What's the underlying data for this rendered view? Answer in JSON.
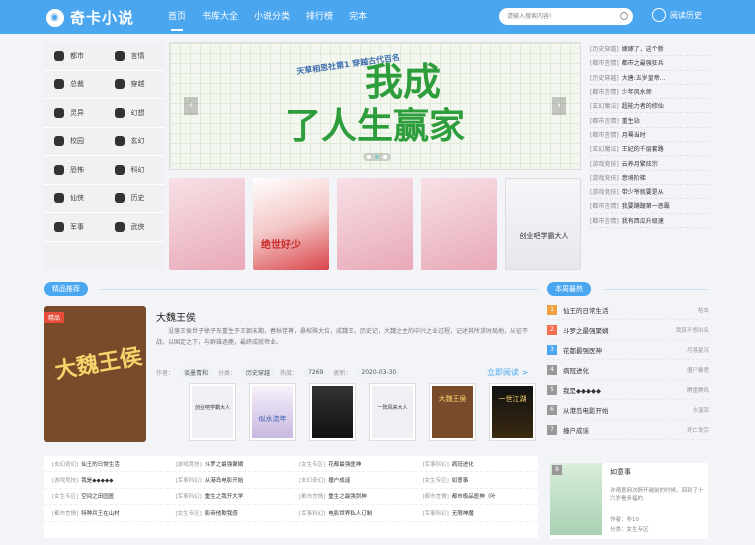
{
  "header": {
    "logo": "奇卡小说",
    "nav": [
      "首页",
      "书库大全",
      "小说分类",
      "排行榜",
      "完本"
    ],
    "search_placeholder": "请输入搜索内容!",
    "history": "阅读历史"
  },
  "categories": [
    "都市",
    "言情",
    "总裁",
    "穿越",
    "灵异",
    "幻想",
    "校园",
    "玄幻",
    "恐怖",
    "科幻",
    "仙侠",
    "历史",
    "军事",
    "武侠"
  ],
  "banner": {
    "subtitle": "天草相思社第1 穿越古代百名",
    "title_line1": "我成",
    "title_line2": "了人生赢家"
  },
  "cover_books": [
    {
      "title": ""
    },
    {
      "title": "绝世好少"
    },
    {
      "title": ""
    },
    {
      "title": ""
    },
    {
      "title": "创业吧学霸大人"
    }
  ],
  "recent_list": [
    {
      "tag": "[历史穿越]",
      "name": "嫁嫁了，这个新"
    },
    {
      "tag": "[都市言情]",
      "name": "都市之最强狂兵"
    },
    {
      "tag": "[历史穿越]",
      "name": "大唐:五岁皇帝..."
    },
    {
      "tag": "[都市言情]",
      "name": "少年风水师"
    },
    {
      "tag": "[玄幻魔法]",
      "name": "超能力者的修仙"
    },
    {
      "tag": "[都市言情]",
      "name": "重生站"
    },
    {
      "tag": "[都市言情]",
      "name": "月蓦当时"
    },
    {
      "tag": "[玄幻魔法]",
      "name": "王妃的千层套路"
    },
    {
      "tag": "[游戏竞技]",
      "name": "云养月繁炫宗"
    },
    {
      "tag": "[游戏竞技]",
      "name": "意境阶梯"
    },
    {
      "tag": "[游戏竞技]",
      "name": "带少爷就要是从"
    },
    {
      "tag": "[都市言情]",
      "name": "我要蹒跚第一恶霸"
    },
    {
      "tag": "[都市言情]",
      "name": "我有西瓜升级速"
    }
  ],
  "sections": {
    "featured": "精品推荐",
    "hot": "本周最热"
  },
  "featured_book": {
    "ribbon": "精品",
    "cover_title": "大魏王侯",
    "title": "大魏王侯",
    "description": "没落王侯世子徐子东重生于王朝末期，春秋荏苒，悬棺殊大位，成魏王。历史记，大魏之主的中兴之业过程，记述其所求时局地，从征不战，以国定之下，与群雄逐鹿，最终成就帝业。",
    "author_label": "作者：",
    "author": "谈墨青和",
    "category_label": "分类：",
    "category": "历史穿越",
    "views_label": "热度：",
    "views": "7269",
    "updated_label": "更新：",
    "updated": "2020-03-30",
    "read_now": "立即阅读 >"
  },
  "thumbs": [
    "创业吧学霸大人",
    "似水流年",
    "",
    "一阵风来大人",
    "大魏王侯",
    "一世江湖"
  ],
  "bottom_list": [
    {
      "tag": "[玄幻奇幻]",
      "name": "仙王的日常生活"
    },
    {
      "tag": "[游戏竞技]",
      "name": "斗罗之最强聚嫡"
    },
    {
      "tag": "[女生专区]",
      "name": "花都最强医神"
    },
    {
      "tag": "[军事科幻]",
      "name": "病冠进化"
    },
    {
      "tag": "[游戏竞技]",
      "name": "我是◆◆◆◆◆"
    },
    {
      "tag": "[军事科幻]",
      "name": "从港岛电影开始"
    },
    {
      "tag": "[玄幻奇幻]",
      "name": "撞户成谣"
    },
    {
      "tag": "[女生专区]",
      "name": "如意事"
    },
    {
      "tag": "[女生专区]",
      "name": "空间之田园医"
    },
    {
      "tag": "[军事科幻]",
      "name": "重生之我开大学"
    },
    {
      "tag": "[都市言情]",
      "name": "重生之最强剑神"
    },
    {
      "tag": "[都市言情]",
      "name": "都市极品医神（叶"
    },
    {
      "tag": "[都市言情]",
      "name": "特种兵王在山村"
    },
    {
      "tag": "[女生专区]",
      "name": "影帝他欺我感"
    },
    {
      "tag": "[军事科幻]",
      "name": "电影世界私人订制"
    },
    {
      "tag": "[军事科幻]",
      "name": "无限神魔"
    }
  ],
  "hot_list": [
    {
      "rank": "1",
      "name": "仙王的日常生活",
      "author": "枯玄"
    },
    {
      "rank": "2",
      "name": "斗罗之最强聚嫡",
      "author": "我真不想出名"
    },
    {
      "rank": "3",
      "name": "花都最强医神",
      "author": "月落星沉"
    },
    {
      "rank": "4",
      "name": "病冠进化",
      "author": "僵尸暴君"
    },
    {
      "rank": "5",
      "name": "我是◆◆◆◆◆",
      "author": "腾墨腾风"
    },
    {
      "rank": "6",
      "name": "从港岛电影开始",
      "author": "水温润"
    },
    {
      "rank": "7",
      "name": "撞户成谣",
      "author": "死亡发宗"
    }
  ],
  "hot_featured": {
    "rank": "8",
    "title": "如意事",
    "description": "许晴意网次醉开越前的时候，回到了十六岁看多福的",
    "author": "作者：非10",
    "category": "分类：女生专区"
  },
  "colors": {
    "accent": "#4ba6f0",
    "rank1": "#f0a040",
    "rank2": "#f07050",
    "rank3": "#4ba6f0"
  }
}
